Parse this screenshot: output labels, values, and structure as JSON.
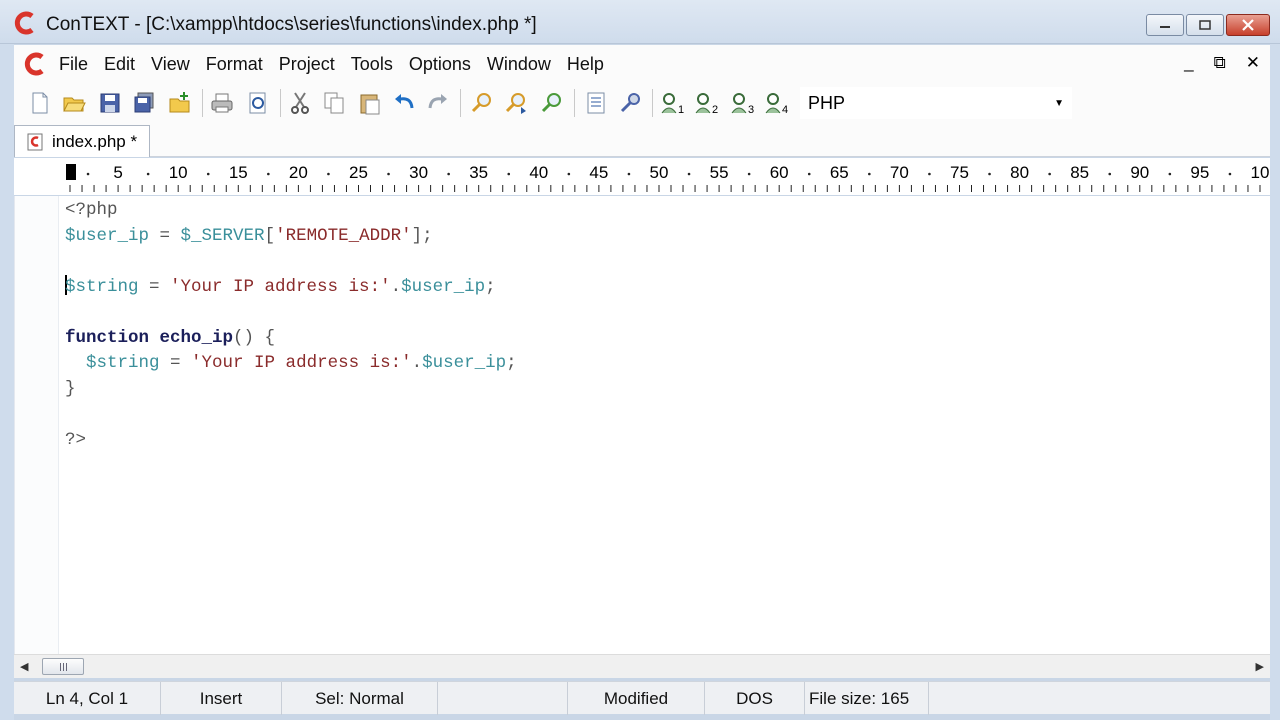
{
  "window": {
    "title": "ConTEXT - [C:\\xampp\\htdocs\\series\\functions\\index.php *]",
    "controls": {
      "minimize": "minimize",
      "maximize": "maximize",
      "close": "close"
    }
  },
  "menu": {
    "items": [
      "File",
      "Edit",
      "View",
      "Format",
      "Project",
      "Tools",
      "Options",
      "Window",
      "Help"
    ],
    "mdi_controls": [
      "_",
      "⧉",
      "✕"
    ]
  },
  "toolbar": {
    "icons": [
      "new-file-icon",
      "open-folder-icon",
      "save-icon",
      "save-all-icon",
      "open-folder-new-icon",
      "print-icon",
      "print-preview-icon",
      "cut-icon",
      "copy-icon",
      "paste-icon",
      "undo-icon",
      "redo-icon",
      "find-icon",
      "find-next-icon",
      "replace-icon",
      "file-list-icon",
      "settings-wrench-icon",
      "user-tool-1-icon",
      "user-tool-2-icon",
      "user-tool-3-icon",
      "user-tool-4-icon"
    ],
    "language": "PHP"
  },
  "tabs": [
    {
      "label": "index.php *",
      "active": true
    }
  ],
  "ruler": {
    "marks": [
      "5",
      "10",
      "15",
      "20",
      "25",
      "30",
      "35",
      "40",
      "45",
      "50",
      "55",
      "60",
      "65",
      "70",
      "75",
      "80",
      "85",
      "90",
      "95",
      "10"
    ]
  },
  "editor": {
    "lines": [
      [
        {
          "t": "<?php",
          "c": "punc"
        }
      ],
      [
        {
          "t": "$user_ip",
          "c": "var"
        },
        {
          "t": " = ",
          "c": "punc"
        },
        {
          "t": "$_SERVER",
          "c": "var"
        },
        {
          "t": "[",
          "c": "punc"
        },
        {
          "t": "'REMOTE_ADDR'",
          "c": "str"
        },
        {
          "t": "];",
          "c": "punc"
        }
      ],
      [],
      [
        {
          "t": "$string",
          "c": "var"
        },
        {
          "t": " = ",
          "c": "punc"
        },
        {
          "t": "'Your IP address is:'",
          "c": "str"
        },
        {
          "t": ".",
          "c": "punc"
        },
        {
          "t": "$user_ip",
          "c": "var"
        },
        {
          "t": ";",
          "c": "punc"
        }
      ],
      [],
      [
        {
          "t": "function",
          "c": "kw"
        },
        {
          "t": " ",
          "c": "punc"
        },
        {
          "t": "echo_ip",
          "c": "kw"
        },
        {
          "t": "() {",
          "c": "punc"
        }
      ],
      [
        {
          "t": "  ",
          "c": "punc"
        },
        {
          "t": "$string",
          "c": "var"
        },
        {
          "t": " = ",
          "c": "punc"
        },
        {
          "t": "'Your IP address is:'",
          "c": "str"
        },
        {
          "t": ".",
          "c": "punc"
        },
        {
          "t": "$user_ip",
          "c": "var"
        },
        {
          "t": ";",
          "c": "punc"
        }
      ],
      [
        {
          "t": "}",
          "c": "punc"
        }
      ],
      [],
      [
        {
          "t": "?>",
          "c": "punc"
        }
      ]
    ]
  },
  "status": {
    "position": "Ln 4, Col 1",
    "mode": "Insert",
    "selection": "Sel: Normal",
    "modified": "Modified",
    "line_endings": "DOS",
    "file_size": "File size: 165"
  },
  "colors": {
    "keyword": "#1b1f5a",
    "variable": "#3a8f9a",
    "string": "#8a2b2b",
    "titlebar": "#dfe8f3",
    "logo": "#d9342b"
  }
}
